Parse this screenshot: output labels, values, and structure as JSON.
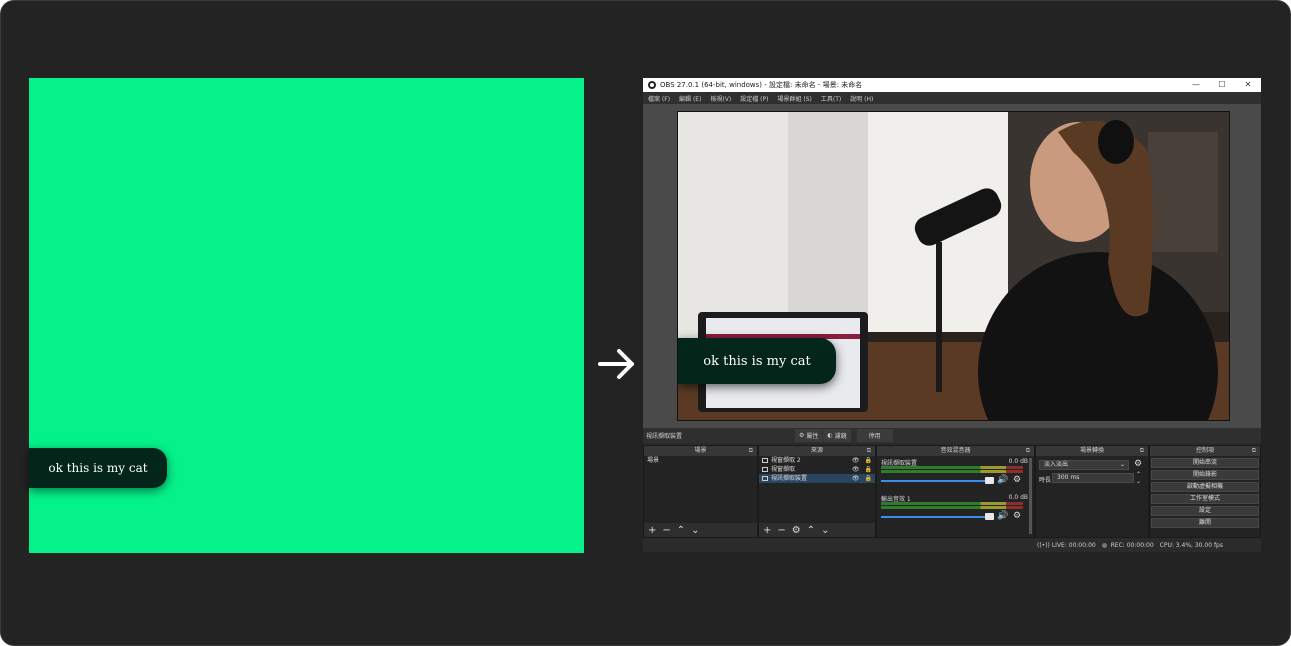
{
  "left_panel": {
    "bg_color": "#05f28a",
    "overlay_text": "ok this is my cat"
  },
  "obs": {
    "title": "OBS 27.0.1 (64-bit, windows) - 設定檔: 未命名 - 場景: 未命名",
    "window_buttons": [
      "—",
      "☐",
      "✕"
    ],
    "menu": [
      "檔案 (F)",
      "編輯 (E)",
      "檢視(V)",
      "設定檔 (P)",
      "場景群組 (S)",
      "工具(T)",
      "說明 (H)"
    ],
    "preview_overlay_text": "ok this is my cat",
    "context_bar": {
      "source_name": "視訊擷取裝置",
      "properties": "屬性",
      "filters": "濾鏡",
      "deactivate": "停用"
    },
    "scenes": {
      "title": "場景",
      "items": [
        "場景"
      ]
    },
    "sources": {
      "title": "來源",
      "items": [
        {
          "name": "視窗擷取 2",
          "selected": false
        },
        {
          "name": "視窗擷取",
          "selected": false
        },
        {
          "name": "視訊擷取裝置",
          "selected": true
        }
      ]
    },
    "mixer": {
      "title": "音效混音器",
      "channels": [
        {
          "name": "視訊擷取裝置",
          "db": "0.0 dB"
        },
        {
          "name": "輸出音效 1",
          "db": "0.0 dB"
        }
      ],
      "ticks": [
        "-60",
        "-55",
        "-50",
        "-45",
        "-40",
        "-35",
        "-30",
        "-25",
        "-20",
        "-15",
        "-10",
        "-5",
        "0"
      ]
    },
    "transitions": {
      "title": "場景轉換",
      "type": "淡入淡出",
      "duration_label": "時長",
      "duration": "300 ms"
    },
    "controls": {
      "title": "控制項",
      "buttons": [
        "開始串流",
        "開始錄影",
        "啟動虛擬相機",
        "工作室模式",
        "設定",
        "離開"
      ]
    },
    "status": {
      "live": "LIVE: 00:00:00",
      "rec": "REC: 00:00:00",
      "cpu": "CPU: 3.4%, 30.00 fps"
    }
  }
}
